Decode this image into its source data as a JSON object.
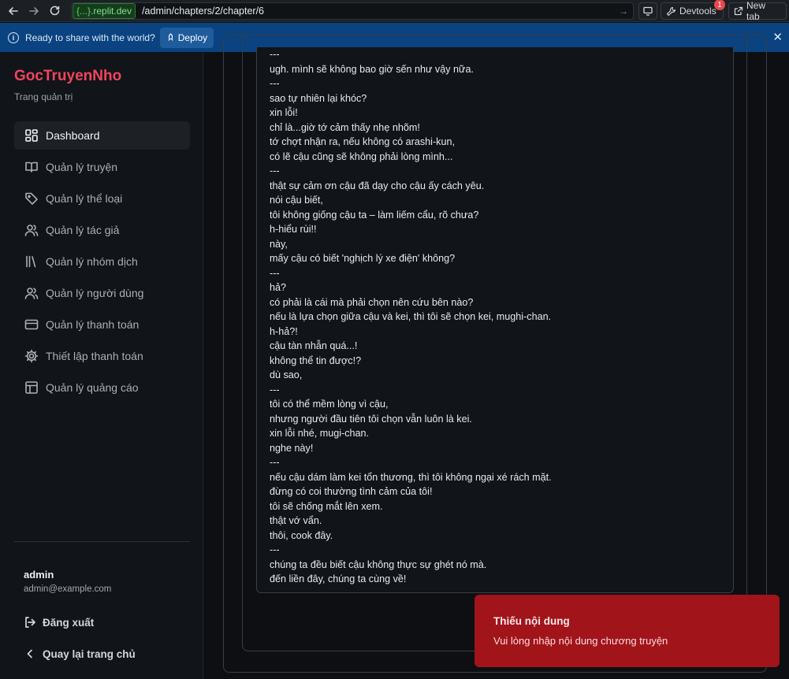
{
  "browser": {
    "domain_prefix": "{...}",
    "domain_suffix": ".replit.dev",
    "path": "/admin/chapters/2/chapter/6",
    "devtools_label": "Devtools",
    "devtools_badge": "1",
    "new_tab_label": "New tab"
  },
  "banner": {
    "text": "Ready to share with the world?",
    "deploy_label": "Deploy"
  },
  "sidebar": {
    "brand": "GocTruyenNho",
    "subtitle": "Trang quản trị",
    "items": [
      {
        "label": "Dashboard",
        "icon": "dashboard-icon"
      },
      {
        "label": "Quản lý truyện",
        "icon": "book-icon"
      },
      {
        "label": "Quản lý thể loại",
        "icon": "tag-icon"
      },
      {
        "label": "Quản lý tác giả",
        "icon": "users-icon"
      },
      {
        "label": "Quản lý nhóm dịch",
        "icon": "library-icon"
      },
      {
        "label": "Quản lý người dùng",
        "icon": "user-group-icon"
      },
      {
        "label": "Quản lý thanh toán",
        "icon": "credit-card-icon"
      },
      {
        "label": "Thiết lập thanh toán",
        "icon": "gear-icon"
      },
      {
        "label": "Quản lý quảng cáo",
        "icon": "layout-icon"
      }
    ],
    "user_name": "admin",
    "user_email": "admin@example.com",
    "logout_label": "Đăng xuất",
    "back_label": "Quay lại trang chủ"
  },
  "chapter": {
    "lines": [
      "---",
      "ugh. mình sẽ không bao giờ sến như vậy nữa.",
      "---",
      "sao tự nhiên lại khóc?",
      "xin lỗi!",
      "chỉ là...giờ tớ cảm thấy nhẹ nhõm!",
      "tớ chợt nhận ra, nếu không có arashi-kun,",
      "có lẽ cậu cũng sẽ không phải lòng mình...",
      "---",
      "thật sự cảm ơn cậu đã dạy cho cậu ấy cách yêu.",
      "nói cậu biết,",
      "tôi không giống cậu ta – làm liếm cẩu, rõ chưa?",
      "h-hiểu rùi!!",
      "này,",
      "mấy cậu có biết 'nghịch lý xe điện' không?",
      "---",
      "hả?",
      "có phải là cái mà phải chọn nên cứu bên nào?",
      "nếu là lựa chọn giữa cậu và kei, thì tôi sẽ chọn kei, mughi-chan.",
      "h-hả?!",
      "cậu tàn nhẫn quá...!",
      "không thể tin được!?",
      "dù sao,",
      "---",
      "tôi có thể mềm lòng vì cậu,",
      "nhưng người đầu tiên tôi chọn vẫn luôn là kei.",
      "xin lỗi nhé, mugi-chan.",
      "nghe này!",
      "---",
      "nếu cậu dám làm kei tổn thương, thì tôi không ngại xé rách mặt.",
      "đừng có coi thường tình cảm của tôi!",
      "tôi sẽ chống mắt lên xem.",
      "thật vớ vẩn.",
      "thôi, cook đây.",
      "---",
      "chúng ta đều biết cậu không thực sự ghét nó mà.",
      "đến liền đây, chúng ta cùng về!"
    ]
  },
  "toast": {
    "title": "Thiếu nội dung",
    "description": "Vui lòng nhập nội dung chương truyện"
  }
}
